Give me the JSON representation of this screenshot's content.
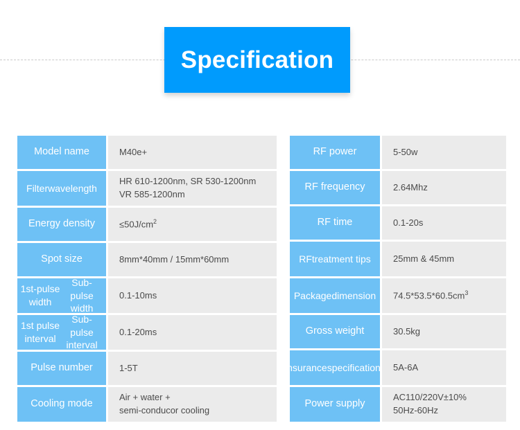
{
  "header": {
    "title": "Specification",
    "title_bg_color": "#009bfd",
    "rule_color": "#c9c9c9"
  },
  "theme": {
    "label_bg_color": "#6ec1f5",
    "value_bg_color": "#ebebeb",
    "label_text_color": "#ffffff",
    "value_text_color": "#4a4a4a",
    "page_bg_color": "#ffffff"
  },
  "left_table": {
    "rows": [
      {
        "label": "Model name",
        "value_lines": [
          "M40e+"
        ]
      },
      {
        "label": "Filter\nwavelength",
        "value_lines": [
          "HR 610-1200nm, SR 530-1200nm",
          "VR 585-1200nm"
        ]
      },
      {
        "label": "Energy density",
        "value_lines": [
          "≤50J/cm²"
        ]
      },
      {
        "label": "Spot size",
        "value_lines": [
          "8mm*40mm / 15mm*60mm"
        ]
      },
      {
        "label": "1st-pulse width\nSub-pulse width",
        "value_lines": [
          "0.1-10ms"
        ]
      },
      {
        "label": "1st pulse interval\nSub-pulse interval",
        "value_lines": [
          "0.1-20ms"
        ]
      },
      {
        "label": "Pulse number",
        "value_lines": [
          "1-5T"
        ]
      },
      {
        "label": "Cooling mode",
        "value_lines": [
          "Air + water +",
          "semi-conducor cooling"
        ]
      }
    ]
  },
  "right_table": {
    "rows": [
      {
        "label": "RF power",
        "value_lines": [
          "5-50w"
        ]
      },
      {
        "label": "RF frequency",
        "value_lines": [
          "2.64Mhz"
        ]
      },
      {
        "label": "RF time",
        "value_lines": [
          "0.1-20s"
        ]
      },
      {
        "label": "RF\ntreatment tips",
        "value_lines": [
          "25mm & 45mm"
        ]
      },
      {
        "label": "Package\ndimension",
        "value_lines": [
          "74.5*53.5*60.5cm³"
        ]
      },
      {
        "label": "Gross weight",
        "value_lines": [
          "30.5kg"
        ]
      },
      {
        "label": "Insurance\nspecifications",
        "value_lines": [
          "5A-6A"
        ]
      },
      {
        "label": "Power supply",
        "value_lines": [
          "AC110/220V±10%",
          "50Hz-60Hz"
        ]
      }
    ]
  }
}
